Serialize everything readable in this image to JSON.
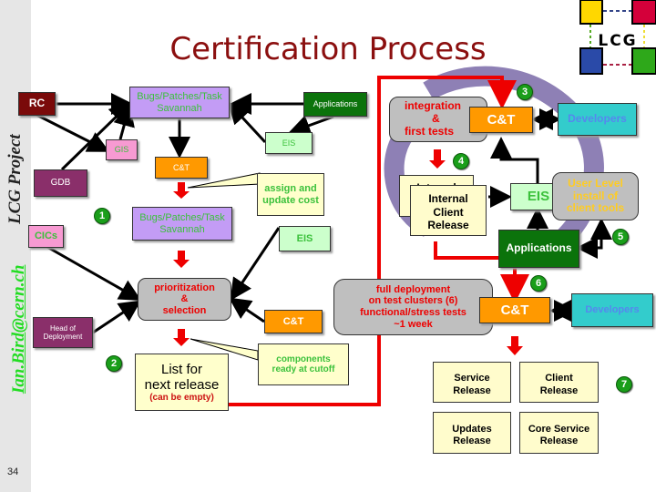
{
  "slide": {
    "title": "Certification Process",
    "sidebar_project": "LCG Project",
    "sidebar_email": "Ian.Bird@cern.ch",
    "page_number": "34",
    "logo_text": "LCG"
  },
  "colors": {
    "title": "#8b0f0f",
    "purple_box": "#c39cf5",
    "orange_box": "#ff9900",
    "dark_green_box": "#0b730b",
    "light_green_box": "#ccffcc",
    "pink_box": "#f79ad2",
    "maroon_box": "#7a0a0a",
    "plum_box": "#8a2f6a",
    "cyan_box": "#33cccc",
    "note_yellow": "#ffffcc",
    "gray_box": "#bfbfbf",
    "red_flow": "#ee0000",
    "badge_green": "#1a9e1a"
  },
  "left_flow": {
    "rc": "RC",
    "savannah_top_line1": "Bugs/Patches/Task",
    "savannah_top_line2": "Savannah",
    "applications_small": "Applications",
    "eis_small": "EIS",
    "gis": "GIS",
    "ct_small": "C&T",
    "gdb": "GDB",
    "badge_1": "1",
    "assign_note_line1": "assign and",
    "assign_note_line2": "update cost",
    "savannah_mid_line1": "Bugs/Patches/Task",
    "savannah_mid_line2": "Savannah",
    "cics": "CICs",
    "eis_mid": "EIS",
    "prioritization_line1": "prioritization",
    "prioritization_line2": "&",
    "prioritization_line3": "selection",
    "head_of_deployment_line1": "Head of",
    "head_of_deployment_line2": "Deployment",
    "ct_mid": "C&T",
    "list_line1": "List for",
    "list_line2": "next release",
    "list_line3": "(can be empty)",
    "badge_2": "2",
    "components_line1": "components",
    "components_line2": "ready at cutoff"
  },
  "right_flow": {
    "integration_line1": "integration",
    "integration_line2": "&",
    "integration_line3": "first tests",
    "badge_3": "3",
    "ct_top": "C&T",
    "developers_top": "Developers",
    "badge_4": "4",
    "internal_back": "Internal",
    "internal_line1": "Internal",
    "internal_line2": "Client",
    "internal_line3": "Release",
    "eis_right": "EIS",
    "user_level_line1": "User Level",
    "user_level_line2": "install of",
    "user_level_line3": "client tools",
    "applications": "Applications",
    "badge_5": "5",
    "full_deploy_line1": "full deployment",
    "full_deploy_line2": "on test clusters (6)",
    "full_deploy_line3": "functional/stress tests",
    "full_deploy_line4": "~1 week",
    "badge_6": "6",
    "ct_bottom": "C&T",
    "developers_bottom": "Developers",
    "service_release_line1": "Service",
    "service_release_line2": "Release",
    "client_release_line1": "Client",
    "client_release_line2": "Release",
    "updates_release_line1": "Updates",
    "updates_release_line2": "Release",
    "core_release_line1": "Core Service",
    "core_release_line2": "Release",
    "badge_7": "7"
  }
}
